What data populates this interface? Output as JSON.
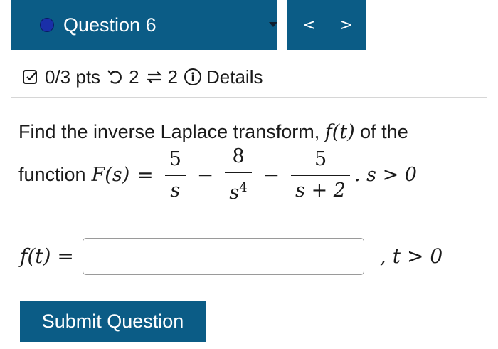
{
  "question": {
    "title": "Question 6",
    "prev_symbol": "<",
    "next_symbol": ">"
  },
  "meta": {
    "points": "0/3 pts",
    "attempts": "2",
    "submissions": "2",
    "details_label": "Details"
  },
  "problem": {
    "intro_text": "Find the inverse Laplace transform,",
    "intro_fn": "f(t)",
    "intro_tail": " of the",
    "function_word": "function",
    "F_s": "F(s)",
    "equals": "=",
    "term1_num": "5",
    "term1_den": "s",
    "minus1": "−",
    "term2_num": "8",
    "term2_den_base": "s",
    "term2_den_exp": "4",
    "minus2": "−",
    "term3_num": "5",
    "term3_den": "s + 2",
    "condition": ". s > 0"
  },
  "answer": {
    "label": "f(t) =",
    "value": "",
    "after": ", t > 0"
  },
  "submit_label": "Submit Question",
  "colors": {
    "header_bg": "#0b5c86",
    "dot": "#1a2fa8",
    "button_bg": "#0b5c86"
  }
}
